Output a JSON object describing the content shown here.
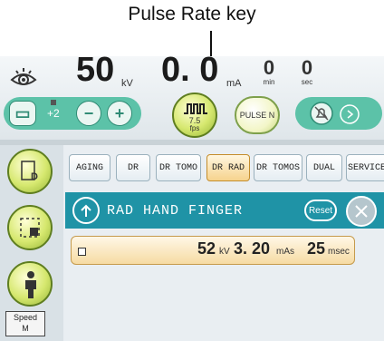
{
  "callout": {
    "label": "Pulse Rate key"
  },
  "readouts": {
    "kv": "50",
    "kv_unit": "kV",
    "ma": "0. 0",
    "ma_unit": "mA",
    "min": "0",
    "min_unit": "min",
    "sec": "0",
    "sec_unit": "sec"
  },
  "controls": {
    "density_value": "+2",
    "minus_label": "−",
    "plus_label": "+",
    "pulse_rate_label": "7.5",
    "pulse_rate_unit": "fps",
    "pulse_n_label": "PULSE N"
  },
  "tabs": [
    "AGING",
    "DR",
    "DR TOMO",
    "DR RAD",
    "DR TOMOS",
    "DUAL",
    "SERVICE"
  ],
  "active_tab": "DR RAD",
  "procedure": {
    "title": "RAD HAND FINGER",
    "reset_label": "Reset"
  },
  "params": {
    "kv": "52",
    "kv_unit": "kV",
    "mas": "3. 20",
    "mas_unit": "mAs",
    "msec": "25",
    "msec_unit": "msec"
  },
  "speed": {
    "label": "Speed",
    "value": "M"
  },
  "colors": {
    "teal_bar": "#1f93a6",
    "green_pill": "#5cc2a8",
    "active_tab": "#f6d38d"
  }
}
